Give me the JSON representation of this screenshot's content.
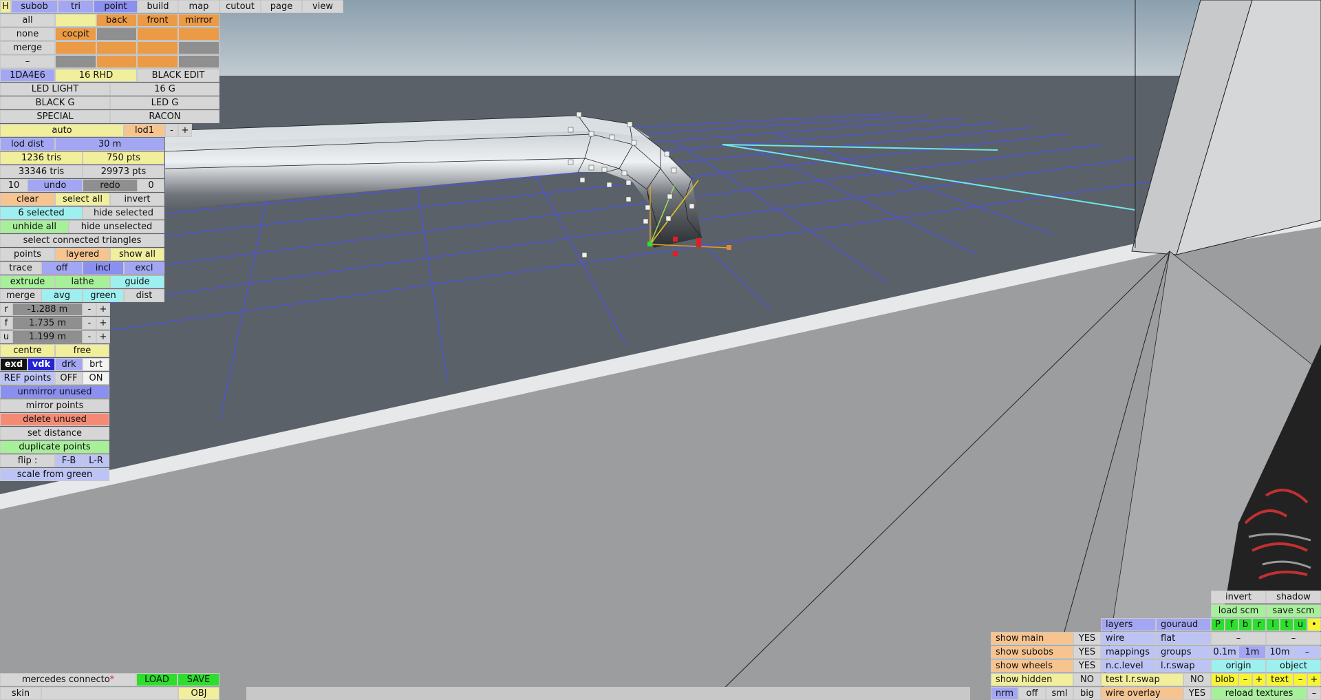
{
  "top_tabs": [
    "H",
    "subob",
    "tri",
    "point",
    "build",
    "map",
    "cutout",
    "page",
    "view"
  ],
  "top_rows": {
    "all": "all",
    "back": "back",
    "front": "front",
    "mirror": "mirror",
    "none": "none",
    "cocpit": "cocpit",
    "merge": "merge",
    "dash": "–"
  },
  "materials": {
    "code": "1DA4E6",
    "rhd": "16 RHD",
    "black_edit": "BLACK EDIT",
    "led_light": "LED LIGHT",
    "g16": "16 G",
    "black_g": "BLACK G",
    "led_g": "LED G",
    "special": "SPECIAL",
    "racon": "RACON"
  },
  "lod": {
    "auto": "auto",
    "level": "lod1",
    "minus": "-",
    "plus": "+",
    "dist_label": "lod dist",
    "dist_value": "30 m"
  },
  "stats": {
    "tris": "1236 tris",
    "pts": "750 pts",
    "total_tris": "33346 tris",
    "total_pts": "29973 pts"
  },
  "undo": {
    "count": "10",
    "undo": "undo",
    "redo": "redo",
    "redo_count": "0"
  },
  "selection": {
    "clear": "clear",
    "select_all": "select all",
    "invert": "invert",
    "selected": "6 selected",
    "hide_selected": "hide selected",
    "unhide_all": "unhide all",
    "hide_unselected": "hide unselected",
    "connected": "select connected triangles",
    "points": "points",
    "layered": "layered",
    "show_all": "show all",
    "trace": "trace",
    "off": "off",
    "incl": "incl",
    "excl": "excl",
    "extrude": "extrude",
    "lathe": "lathe",
    "guide": "guide",
    "merge": "merge",
    "avg": "avg",
    "green": "green",
    "dist": "dist"
  },
  "coords": [
    {
      "axis": "r",
      "value": "-1.288 m"
    },
    {
      "axis": "f",
      "value": "1.735 m"
    },
    {
      "axis": "u",
      "value": "1.199 m"
    }
  ],
  "pos": {
    "centre": "centre",
    "free": "free"
  },
  "view_modes": {
    "exd": "exd",
    "vdk": "vdk",
    "drk": "drk",
    "brt": "brt"
  },
  "ref": {
    "label": "REF points",
    "off": "OFF",
    "on": "ON"
  },
  "actions": {
    "unmirror": "unmirror unused",
    "mirror_points": "mirror points",
    "delete_unused": "delete unused",
    "set_distance": "set distance",
    "duplicate": "duplicate points",
    "flip": "flip :",
    "fb": "F-B",
    "lr": "L-R",
    "scale": "scale from green"
  },
  "file": {
    "name": "mercedes connecto",
    "star": "*",
    "load": "LOAD",
    "save": "SAVE",
    "skin": "skin",
    "obj": "OBJ"
  },
  "display_left": [
    {
      "label": "show main",
      "value": "YES"
    },
    {
      "label": "show subobs",
      "value": "YES"
    },
    {
      "label": "show wheels",
      "value": "YES"
    },
    {
      "label": "show hidden",
      "value": "NO"
    }
  ],
  "render": {
    "nrm": "nrm",
    "off": "off",
    "sml": "sml",
    "big": "big"
  },
  "display_mid": {
    "layers": "layers",
    "gouraud": "gouraud",
    "wire": "wire",
    "flat": "flat",
    "mappings": "mappings",
    "groups": "groups",
    "nclevel": "n.c.level",
    "lrswap": "l.r.swap",
    "test_lrswap": "test l.r.swap",
    "test_no": "NO",
    "wire_overlay": "wire overlay",
    "wire_yes": "YES"
  },
  "display_right": {
    "invert": "invert",
    "shadow": "shadow",
    "load_scm": "load scm",
    "save_scm": "save scm",
    "letters": [
      "P",
      "f",
      "b",
      "r",
      "l",
      "t",
      "u",
      "•"
    ],
    "dash": "–",
    "dash2": "–",
    "s01": "0.1m",
    "s1": "1m",
    "s10": "10m",
    "sdash": "–",
    "origin": "origin",
    "object": "object",
    "blob": "blob",
    "minus": "–",
    "plus": "+",
    "text": "text",
    "reload": "reload textures"
  },
  "colors": {
    "sky_top": "#8a9fae",
    "sky_bottom": "#c3cbd1",
    "floor": "#5a6168",
    "grid": "#4d55e0",
    "ground": "#9b9d9f"
  }
}
